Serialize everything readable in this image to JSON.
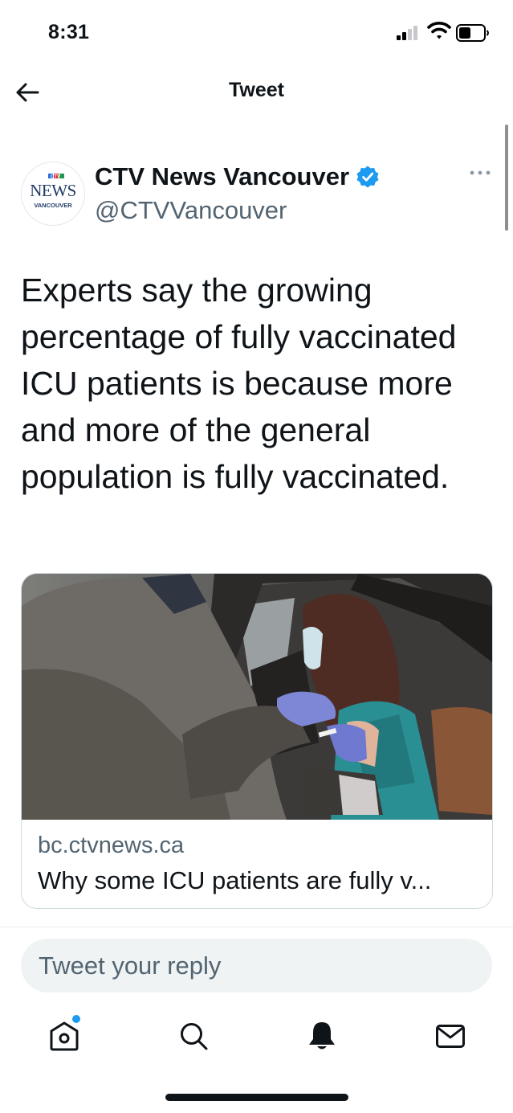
{
  "status_bar": {
    "time": "8:31"
  },
  "header": {
    "title": "Tweet"
  },
  "tweet": {
    "author_name": "CTV News Vancouver",
    "author_handle": "@CTVVancouver",
    "avatar_text": {
      "top": "CTV",
      "main": "NEWS",
      "sub": "VANCOUVER"
    },
    "text": "Experts say the growing percentage of fully vaccinated ICU patients is because more and more of the general population is fully vaccinated.",
    "link_card": {
      "domain": "bc.ctvnews.ca",
      "title": "Why some ICU patients are fully v..."
    }
  },
  "reply": {
    "placeholder": "Tweet your reply"
  },
  "tab_bar": {
    "items": [
      "home-icon",
      "search-icon",
      "notifications-bell-icon",
      "messages-mail-icon"
    ],
    "active": "home-icon"
  },
  "colors": {
    "accent": "#1d9bf0",
    "text_primary": "#0f1419",
    "text_secondary": "#536471",
    "reply_bg": "#eff3f4",
    "ctv_red": "#d3282e"
  }
}
